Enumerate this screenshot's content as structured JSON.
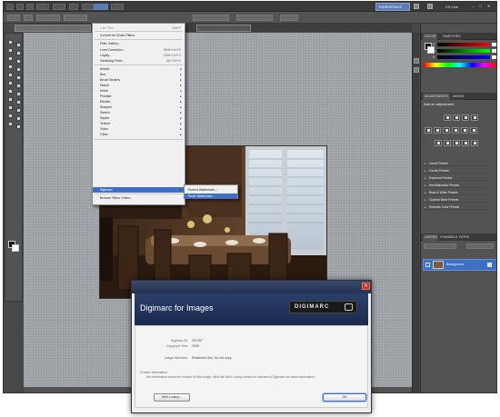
{
  "app": {
    "workspace_label": "ESSENTIALS",
    "cs_live_label": "CS Live",
    "min_symbol": "–",
    "max_symbol": "□",
    "close_symbol": "✕"
  },
  "filter_menu": {
    "items": [
      {
        "label": "Last Filter",
        "shortcut": "Ctrl+F",
        "dim": true
      },
      {
        "label": "Convert for Smart Filters",
        "shortcut": ""
      },
      {
        "label": "Filter Gallery...",
        "shortcut": ""
      },
      {
        "label": "Lens Correction...",
        "shortcut": "Shift+Ctrl+R"
      },
      {
        "label": "Liquify...",
        "shortcut": "Shift+Ctrl+X"
      },
      {
        "label": "Vanishing Point...",
        "shortcut": "Alt+Ctrl+V"
      },
      {
        "label": "Artistic",
        "arrow": "▸"
      },
      {
        "label": "Blur",
        "arrow": "▸"
      },
      {
        "label": "Brush Strokes",
        "arrow": "▸"
      },
      {
        "label": "Distort",
        "arrow": "▸"
      },
      {
        "label": "Noise",
        "arrow": "▸"
      },
      {
        "label": "Pixelate",
        "arrow": "▸"
      },
      {
        "label": "Render",
        "arrow": "▸"
      },
      {
        "label": "Sharpen",
        "arrow": "▸"
      },
      {
        "label": "Sketch",
        "arrow": "▸"
      },
      {
        "label": "Stylize",
        "arrow": "▸"
      },
      {
        "label": "Texture",
        "arrow": "▸"
      },
      {
        "label": "Video",
        "arrow": "▸"
      },
      {
        "label": "Other",
        "arrow": "▸"
      },
      {
        "label": "Digimarc",
        "arrow": "▸",
        "selected": true
      },
      {
        "label": "Browse Filters Online...",
        "shortcut": ""
      }
    ]
  },
  "digimarc_submenu": {
    "items": [
      {
        "label": "Embed Watermark..."
      },
      {
        "label": "Read Watermark...",
        "selected": true
      }
    ]
  },
  "panels": {
    "color_tabs": [
      "COLOR",
      "SWATCHES"
    ],
    "color_sliders": [
      {
        "label": "R",
        "color": "#e04040"
      },
      {
        "label": "G",
        "color": "#40c040"
      },
      {
        "label": "B",
        "color": "#4060e0"
      }
    ],
    "adjustments_tabs": [
      "ADJUSTMENTS",
      "MASKS"
    ],
    "adjustments_title": "Add an adjustment",
    "presets": [
      "Levels Presets",
      "Curves Presets",
      "Exposure Presets",
      "Hue/Saturation Presets",
      "Black & White Presets",
      "Channel Mixer Presets",
      "Selective Color Presets"
    ],
    "layers_tabs": [
      "LAYERS",
      "CHANNELS",
      "PATHS"
    ],
    "layer_name": "Background"
  },
  "dialog": {
    "heading": "Digimarc for Images",
    "logo_text": "DIGIMARC",
    "info": [
      {
        "label": "Digimarc ID:",
        "value": "307437"
      },
      {
        "label": "Copyright Year:",
        "value": "2009"
      },
      {
        "label": "Image Attributes:",
        "value": "Restricted Use, Do not copy"
      }
    ],
    "note_title": "Creator Information",
    "note": "No information about the creator of this image, click the Web Lookup button to connect to Digimarc for more information.",
    "web_lookup_label": "Web Lookup...",
    "ok_label": "OK"
  }
}
